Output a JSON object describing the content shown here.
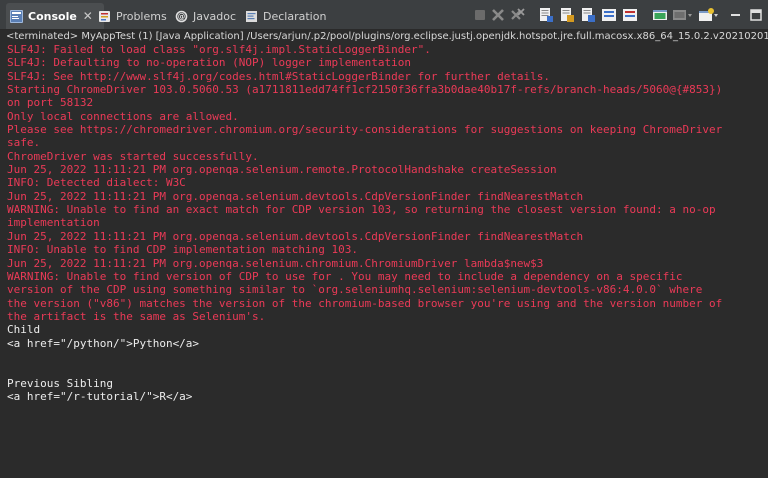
{
  "tabs": [
    {
      "label": "Console",
      "active": true,
      "icon": "console-icon"
    },
    {
      "label": "Problems",
      "active": false,
      "icon": "problems-icon"
    },
    {
      "label": "Javadoc",
      "active": false,
      "icon": "javadoc-icon"
    },
    {
      "label": "Declaration",
      "active": false,
      "icon": "declaration-icon"
    }
  ],
  "close_glyph": "✕",
  "process_line": "<terminated> MyAppTest (1) [Java Application] /Users/arjun/.p2/pool/plugins/org.eclipse.justj.openjdk.hotspot.jre.full.macosx.x86_64_15.0.2.v20210201",
  "colors": {
    "stderr": "#ea3a57",
    "stdout": "#ececec",
    "background": "#2b2b2b",
    "tabbar": "#3c3f41"
  },
  "toolbar_icons": [
    "terminate-icon",
    "remove-launch-icon",
    "remove-all-terminated-icon",
    "scroll-lock-icon",
    "word-wrap-icon",
    "show-stdout-icon",
    "show-stderr-icon",
    "pin-console-icon",
    "display-selected-console-icon",
    "open-console-icon",
    "minimize-icon",
    "maximize-icon"
  ],
  "console_lines": [
    {
      "text": "SLF4J: Failed to load class \"org.slf4j.impl.StaticLoggerBinder\".",
      "stream": "err"
    },
    {
      "text": "SLF4J: Defaulting to no-operation (NOP) logger implementation",
      "stream": "err"
    },
    {
      "text": "SLF4J: See http://www.slf4j.org/codes.html#StaticLoggerBinder for further details.",
      "stream": "err"
    },
    {
      "text": "Starting ChromeDriver 103.0.5060.53 (a1711811edd74ff1cf2150f36ffa3b0dae40b17f-refs/branch-heads/5060@{#853})",
      "stream": "err"
    },
    {
      "text": "on port 58132",
      "stream": "err"
    },
    {
      "text": "Only local connections are allowed.",
      "stream": "err"
    },
    {
      "text": "Please see https://chromedriver.chromium.org/security-considerations for suggestions on keeping ChromeDriver",
      "stream": "err"
    },
    {
      "text": "safe.",
      "stream": "err"
    },
    {
      "text": "ChromeDriver was started successfully.",
      "stream": "err"
    },
    {
      "text": "Jun 25, 2022 11:11:21 PM org.openqa.selenium.remote.ProtocolHandshake createSession",
      "stream": "err"
    },
    {
      "text": "INFO: Detected dialect: W3C",
      "stream": "err"
    },
    {
      "text": "Jun 25, 2022 11:11:21 PM org.openqa.selenium.devtools.CdpVersionFinder findNearestMatch",
      "stream": "err"
    },
    {
      "text": "WARNING: Unable to find an exact match for CDP version 103, so returning the closest version found: a no-op",
      "stream": "err"
    },
    {
      "text": "implementation",
      "stream": "err"
    },
    {
      "text": "Jun 25, 2022 11:11:21 PM org.openqa.selenium.devtools.CdpVersionFinder findNearestMatch",
      "stream": "err"
    },
    {
      "text": "INFO: Unable to find CDP implementation matching 103.",
      "stream": "err"
    },
    {
      "text": "Jun 25, 2022 11:11:21 PM org.openqa.selenium.chromium.ChromiumDriver lambda$new$3",
      "stream": "err"
    },
    {
      "text": "WARNING: Unable to find version of CDP to use for . You may need to include a dependency on a specific",
      "stream": "err"
    },
    {
      "text": "version of the CDP using something similar to `org.seleniumhq.selenium:selenium-devtools-v86:4.0.0` where",
      "stream": "err"
    },
    {
      "text": "the version (\"v86\") matches the version of the chromium-based browser you're using and the version number of",
      "stream": "err"
    },
    {
      "text": "the artifact is the same as Selenium's.",
      "stream": "err"
    },
    {
      "text": "Child",
      "stream": "out"
    },
    {
      "text": "<a href=\"/python/\">Python</a>",
      "stream": "out"
    },
    {
      "text": "",
      "stream": "out"
    },
    {
      "text": "",
      "stream": "out"
    },
    {
      "text": "Previous Sibling",
      "stream": "out"
    },
    {
      "text": "<a href=\"/r-tutorial/\">R</a>",
      "stream": "out"
    }
  ]
}
